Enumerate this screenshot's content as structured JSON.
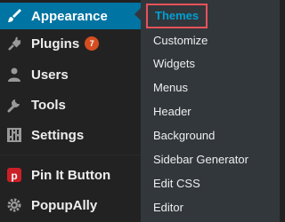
{
  "menu": {
    "items": [
      {
        "label": "Appearance",
        "icon": "paintbrush-icon"
      },
      {
        "label": "Plugins",
        "icon": "plugin-icon",
        "badge": "7"
      },
      {
        "label": "Users",
        "icon": "user-icon"
      },
      {
        "label": "Tools",
        "icon": "wrench-icon"
      },
      {
        "label": "Settings",
        "icon": "sliders-icon"
      },
      {
        "label": "Pin It Button",
        "icon": "pinterest-icon"
      },
      {
        "label": "PopupAlly",
        "icon": "gear-icon"
      }
    ]
  },
  "submenu": {
    "items": [
      {
        "label": "Themes",
        "current": true
      },
      {
        "label": "Customize"
      },
      {
        "label": "Widgets"
      },
      {
        "label": "Menus"
      },
      {
        "label": "Header"
      },
      {
        "label": "Background"
      },
      {
        "label": "Sidebar Generator"
      },
      {
        "label": "Edit CSS"
      },
      {
        "label": "Editor"
      }
    ]
  },
  "colors": {
    "menu_bg": "#222222",
    "active_bg": "#0074a2",
    "submenu_bg": "#32373c",
    "current_text": "#00a0d2",
    "highlight_border": "#e8525a",
    "badge_bg": "#d54e21"
  }
}
